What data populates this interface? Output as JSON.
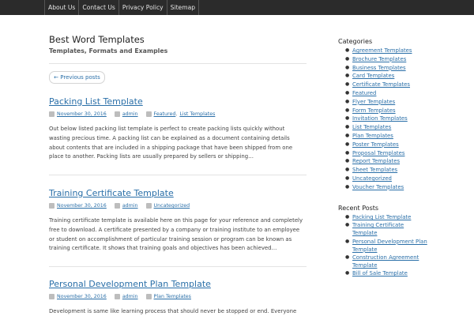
{
  "nav": [
    "About Us",
    "Contact Us",
    "Privacy Policy",
    "Sitemap"
  ],
  "site": {
    "title": "Best Word Templates",
    "description": "Templates, Formats and Examples"
  },
  "pagination": {
    "prev_label": "← Previous posts"
  },
  "posts": [
    {
      "title": "Packing List Template",
      "date": "November 30, 2016",
      "author": "admin",
      "categories": [
        "Featured",
        "List Templates"
      ],
      "excerpt": "Out below listed packing list template is perfect to create packing lists quickly without wasting precious time. A packing list can be explained as a document containing details about contents that are included in a shipping package that have been shipped from one place to another. Packing lists are usually prepared by sellers or shipping…"
    },
    {
      "title": "Training Certificate Template",
      "date": "November 30, 2016",
      "author": "admin",
      "categories": [
        "Uncategorized"
      ],
      "excerpt": "Training certificate template is available here on this page for your reference and completely free to download. A certificate presented by a company or training institute to an employee or student on accomplishment of particular training session or program can be known as training certificate. It shows that training goals and objectives has been achieved…"
    },
    {
      "title": "Personal Development Plan Template",
      "date": "November 30, 2016",
      "author": "admin",
      "categories": [
        "Plan Templates"
      ],
      "excerpt": "Development is same like learning process that should never be stopped or end. Everyone should keep"
    }
  ],
  "sidebar": {
    "categories_heading": "Categories",
    "categories": [
      "Agreement Templates",
      "Brochure Templates",
      "Business Templates",
      "Card Templates",
      "Certificate Templates",
      "Featured",
      "Flyer Templates",
      "Form Templates",
      "Invitation Templates",
      "List Templates",
      "Plan Templates",
      "Poster Templates",
      "Proposal Templates",
      "Report Templates",
      "Sheet Templates",
      "Uncategorized",
      "Voucher Templates"
    ],
    "recent_heading": "Recent Posts",
    "recent": [
      [
        "Packing List Template"
      ],
      [
        "Training Certificate",
        "Template"
      ],
      [
        "Personal Development Plan",
        "Template"
      ],
      [
        "Construction Agreement",
        "Template"
      ],
      [
        "Bill of Sale Template"
      ]
    ]
  },
  "icons": {
    "calendar": "calendar-icon",
    "author": "user-icon",
    "category": "folder-icon"
  },
  "colors": {
    "link": "#2a6fa8",
    "nav_bg": "#2b2b2b"
  }
}
